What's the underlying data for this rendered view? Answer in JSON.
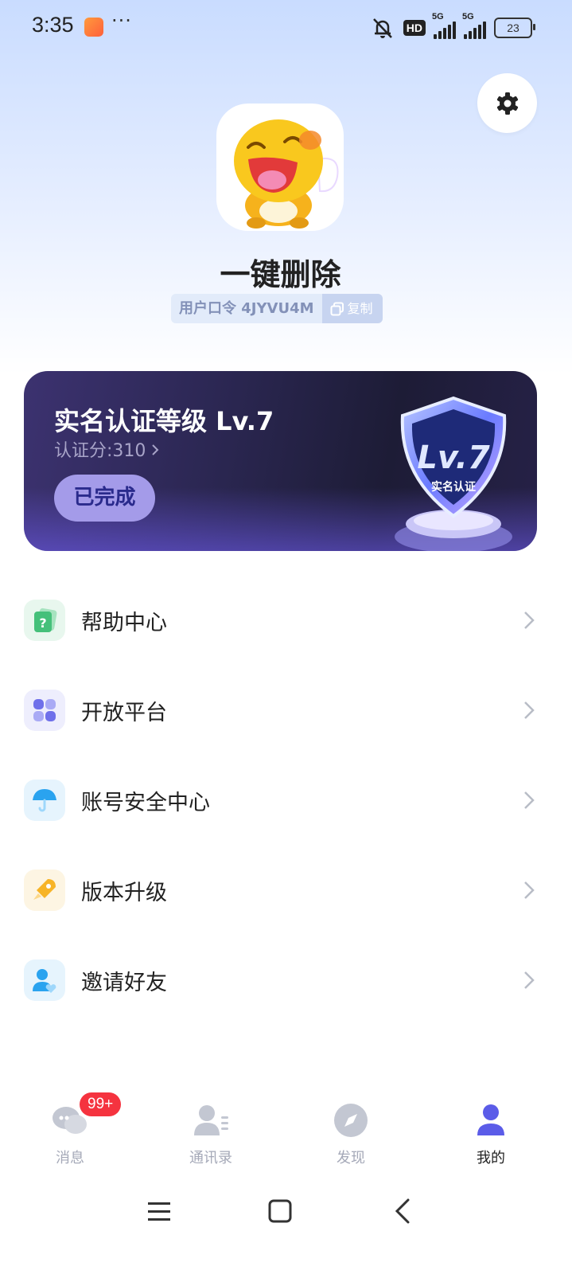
{
  "status_bar": {
    "time": "3:35",
    "dots": "···",
    "hd": "HD",
    "network_1": "5G",
    "network_2": "5G",
    "battery": "23"
  },
  "profile": {
    "name": "一键删除",
    "user_code": "用户口令 4JYVU4M",
    "copy_label": "复制"
  },
  "certification": {
    "title": "实名认证等级 Lv.7",
    "score": "认证分:310",
    "status_button": "已完成",
    "badge_level": "Lv.7",
    "badge_text": "实名认证"
  },
  "menu": {
    "items": [
      {
        "label": "帮助中心",
        "icon": "help-card-icon",
        "color": "#e8f7ee"
      },
      {
        "label": "开放平台",
        "icon": "grid-apps-icon",
        "color": "#eeeefd"
      },
      {
        "label": "账号安全中心",
        "icon": "umbrella-icon",
        "color": "#e6f4fd"
      },
      {
        "label": "版本升级",
        "icon": "rocket-icon",
        "color": "#fdf5e3"
      },
      {
        "label": "邀请好友",
        "icon": "person-heart-icon",
        "color": "#e6f4fd"
      }
    ]
  },
  "tabs": {
    "messages": "消息",
    "contacts": "通讯录",
    "discover": "发现",
    "me": "我的",
    "unread": "99+"
  },
  "colors": {
    "accent": "#5b5ce8",
    "badge_red": "#f5333f"
  }
}
